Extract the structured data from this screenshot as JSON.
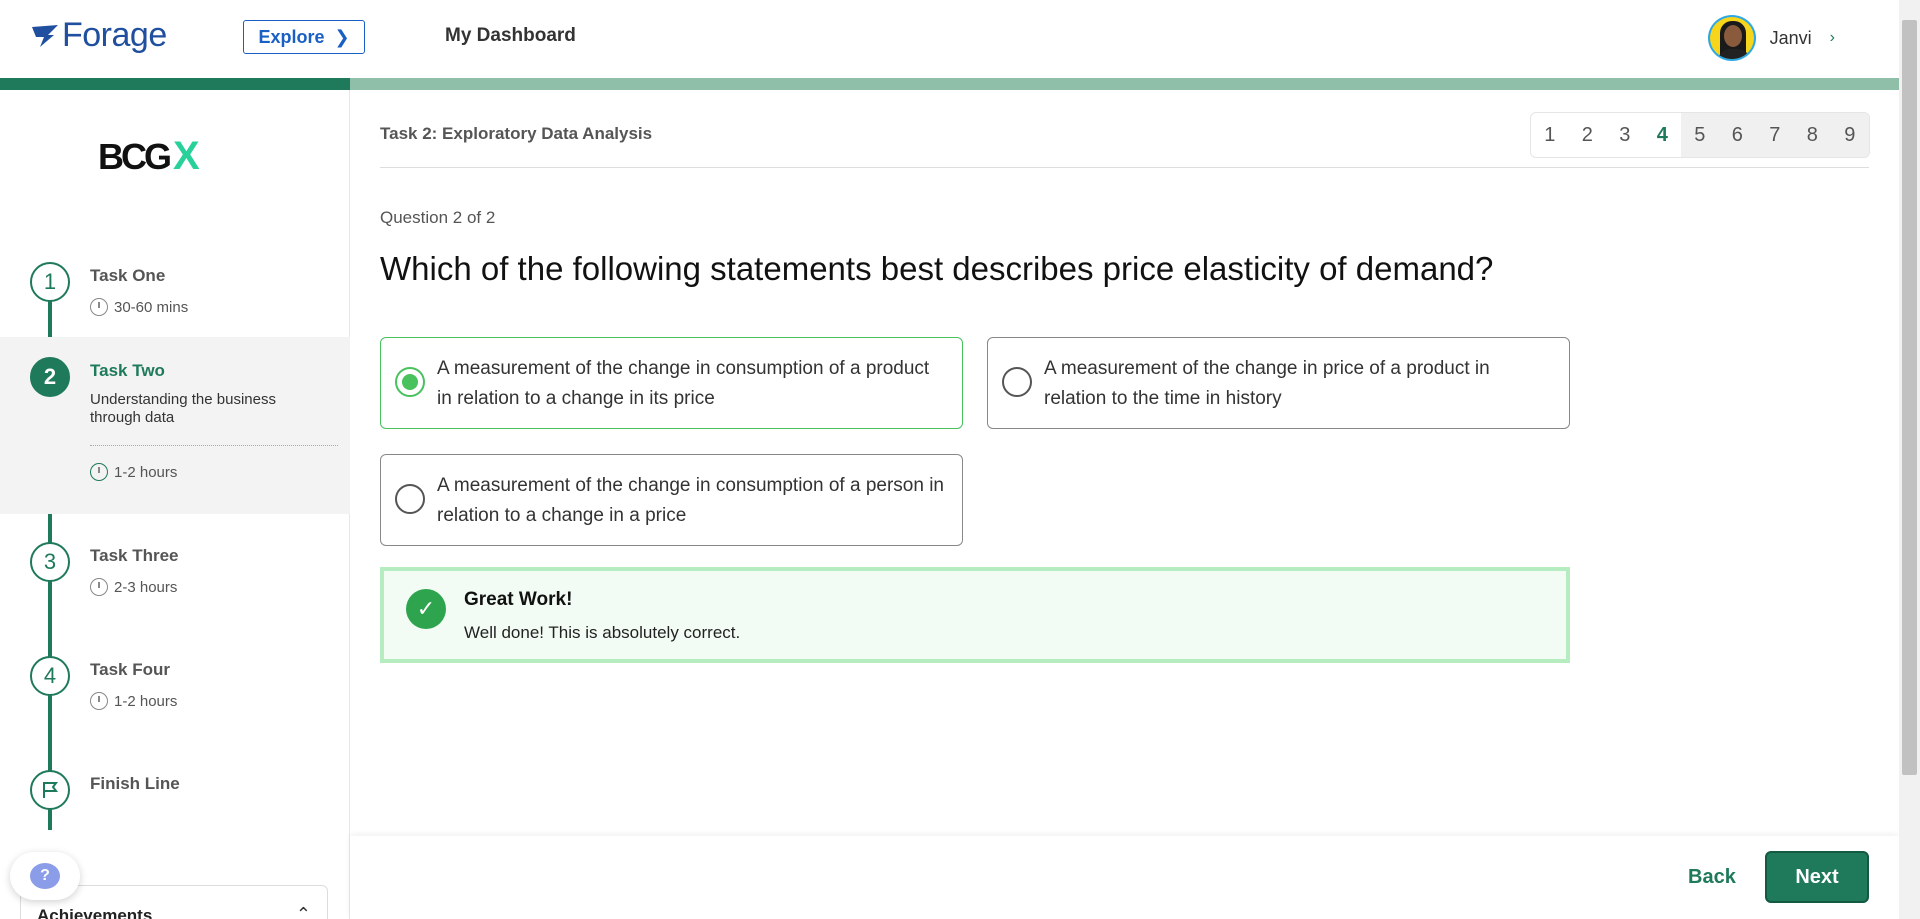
{
  "header": {
    "brand": "Forage",
    "explore_label": "Explore",
    "dashboard_label": "My Dashboard",
    "user_name": "Janvi"
  },
  "sidebar": {
    "company_logo": "BCG X",
    "tasks": [
      {
        "number": "1",
        "title": "Task One",
        "time": "30-60 mins"
      },
      {
        "number": "2",
        "title": "Task Two",
        "description": "Understanding the business through data",
        "time": "1-2 hours"
      },
      {
        "number": "3",
        "title": "Task Three",
        "time": "2-3 hours"
      },
      {
        "number": "4",
        "title": "Task Four",
        "time": "1-2 hours"
      },
      {
        "number": "",
        "title": "Finish Line"
      }
    ],
    "help_label": "?",
    "achievements_label": "Achievements"
  },
  "main": {
    "task_header": "Task 2: Exploratory Data Analysis",
    "pages": [
      "1",
      "2",
      "3",
      "4",
      "5",
      "6",
      "7",
      "8",
      "9"
    ],
    "current_page": "4",
    "question_counter": "Question 2 of 2",
    "question": "Which of the following statements best describes price elasticity of demand?",
    "options": [
      {
        "text": "A measurement of the change in consumption of a product in relation to a change in its price",
        "selected": true
      },
      {
        "text": "A measurement of the change in price of a product in relation to the time in history",
        "selected": false
      },
      {
        "text": "A measurement of the change in consumption of a person in relation to a change in a price",
        "selected": false
      }
    ],
    "feedback": {
      "title": "Great Work!",
      "message": "Well done! This is absolutely correct."
    }
  },
  "footer": {
    "back_label": "Back",
    "next_label": "Next"
  },
  "colors": {
    "brand_green": "#1e7a5a",
    "brand_blue": "#1f4f9e",
    "success_green": "#49c15d"
  }
}
